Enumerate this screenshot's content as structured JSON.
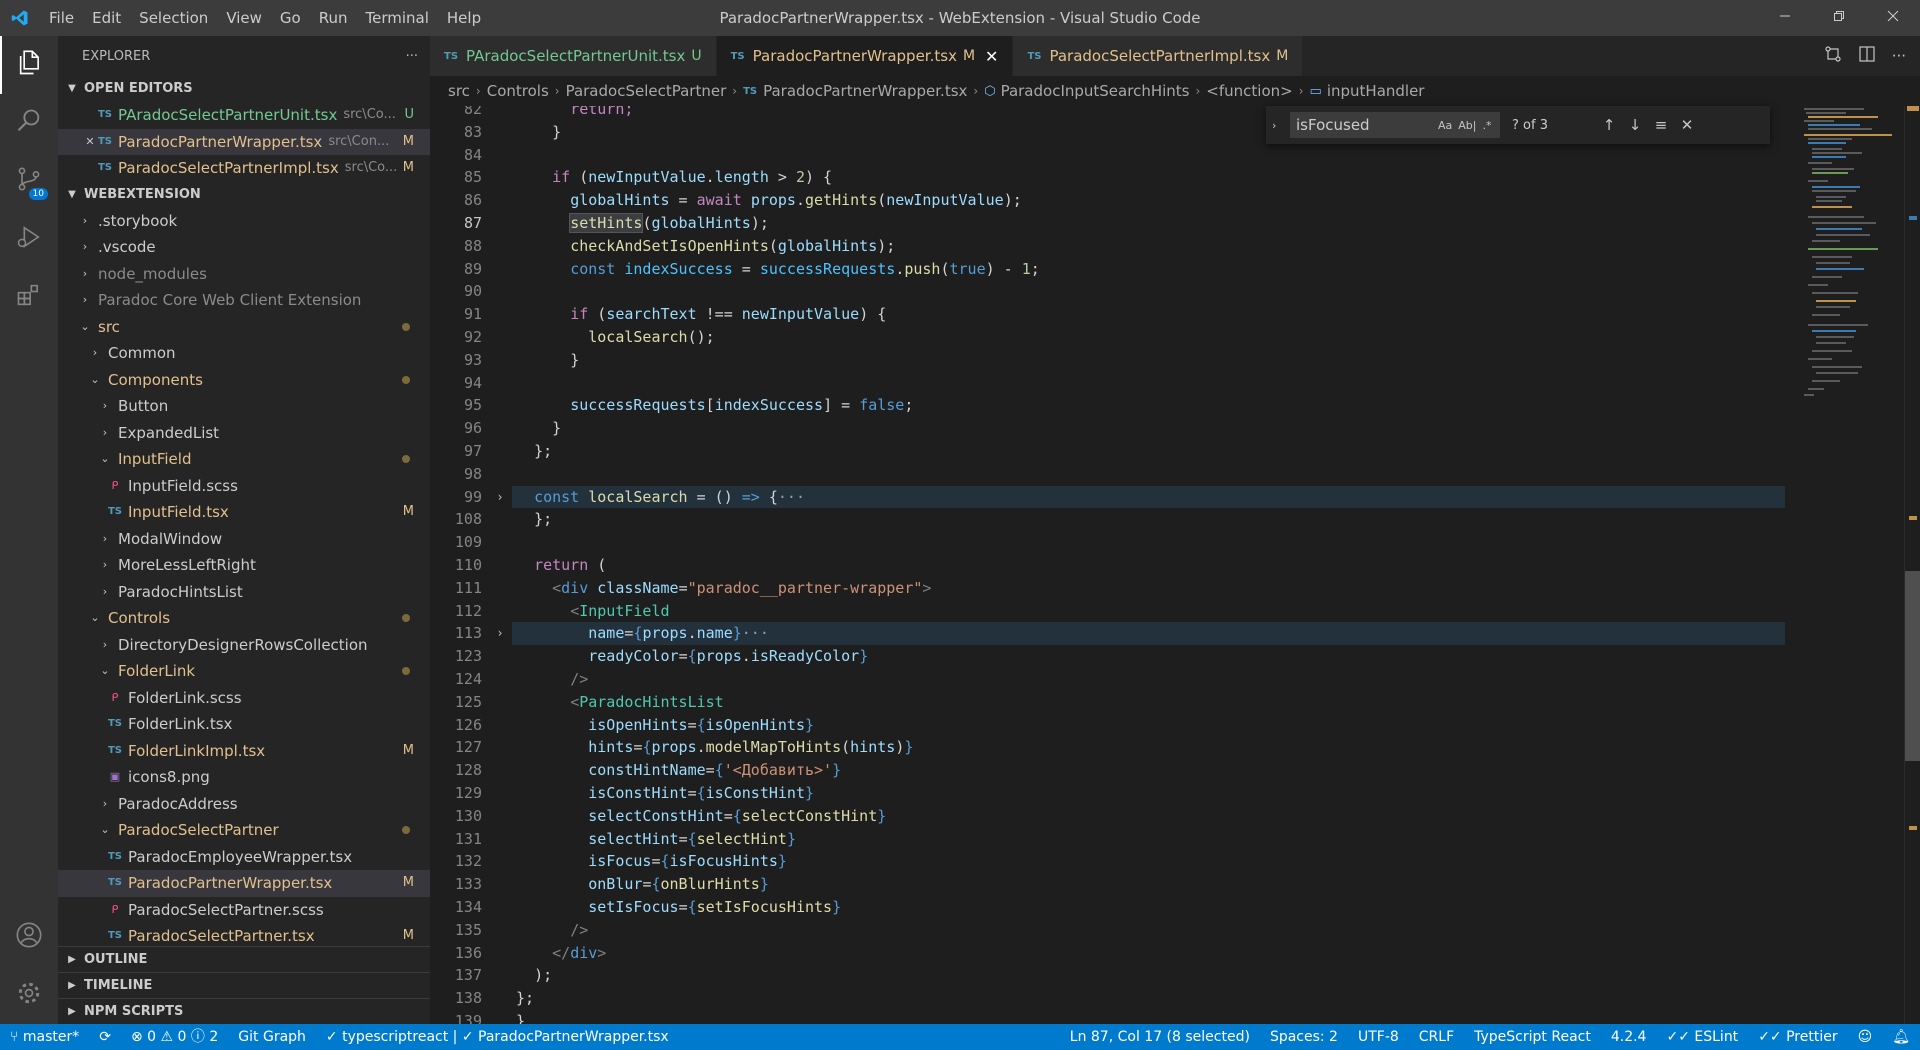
{
  "titlebar": {
    "menu": [
      "File",
      "Edit",
      "Selection",
      "View",
      "Go",
      "Run",
      "Terminal",
      "Help"
    ],
    "title": "ParadocPartnerWrapper.tsx - WebExtension - Visual Studio Code"
  },
  "activity": {
    "scm_badge": "10"
  },
  "sidebar": {
    "header": "EXPLORER",
    "more": "···",
    "open_editors": {
      "title": "OPEN EDITORS",
      "items": [
        {
          "name": "PAradocSelectPartnerUnit.tsx",
          "path": "src\\Co...",
          "status": "U"
        },
        {
          "name": "ParadocPartnerWrapper.tsx",
          "path": "src\\Con...",
          "status": "M"
        },
        {
          "name": "ParadocSelectPartnerImpl.tsx",
          "path": "src\\Co...",
          "status": "M"
        }
      ]
    },
    "workspace": {
      "title": "WEBEXTENSION",
      "items": [
        {
          "name": ".storybook"
        },
        {
          "name": ".vscode"
        },
        {
          "name": "node_modules"
        },
        {
          "name": "Paradoc Core Web Client Extension"
        },
        {
          "name": "src"
        },
        {
          "name": "Common"
        },
        {
          "name": "Components"
        },
        {
          "name": "Button"
        },
        {
          "name": "ExpandedList"
        },
        {
          "name": "InputField"
        },
        {
          "name": "InputField.scss"
        },
        {
          "name": "InputField.tsx",
          "status": "M"
        },
        {
          "name": "ModalWindow"
        },
        {
          "name": "MoreLessLeftRight"
        },
        {
          "name": "ParadocHintsList"
        },
        {
          "name": "Controls"
        },
        {
          "name": "DirectoryDesignerRowsCollection"
        },
        {
          "name": "FolderLink"
        },
        {
          "name": "FolderLink.scss"
        },
        {
          "name": "FolderLink.tsx"
        },
        {
          "name": "FolderLinkImpl.tsx",
          "status": "M"
        },
        {
          "name": "icons8.png"
        },
        {
          "name": "ParadocAddress"
        },
        {
          "name": "ParadocSelectPartner"
        },
        {
          "name": "ParadocEmployeeWrapper.tsx"
        },
        {
          "name": "ParadocPartnerWrapper.tsx",
          "status": "M"
        },
        {
          "name": "ParadocSelectPartner.scss"
        },
        {
          "name": "ParadocSelectPartner.tsx",
          "status": "M"
        }
      ]
    },
    "bottom_sections": [
      "OUTLINE",
      "TIMELINE",
      "NPM SCRIPTS"
    ]
  },
  "tabs": [
    {
      "name": "PAradocSelectPartnerUnit.tsx",
      "status": "U"
    },
    {
      "name": "ParadocPartnerWrapper.tsx",
      "status": "M"
    },
    {
      "name": "ParadocSelectPartnerImpl.tsx",
      "status": "M"
    }
  ],
  "breadcrumb": [
    "src",
    "Controls",
    "ParadocSelectPartner",
    "ParadocPartnerWrapper.tsx",
    "ParadocInputSearchHints",
    "<function>",
    "inputHandler"
  ],
  "find": {
    "value": "isFocused",
    "count": "? of 3",
    "opt_case": "Aa",
    "opt_word": "Ab|",
    "opt_regex": ".*"
  },
  "editor": {
    "line_numbers": [
      "82",
      "83",
      "84",
      "85",
      "86",
      "87",
      "88",
      "89",
      "90",
      "91",
      "92",
      "93",
      "94",
      "95",
      "96",
      "97",
      "98",
      "99",
      "108",
      "109",
      "110",
      "111",
      "112",
      "113",
      "123",
      "124",
      "125",
      "126",
      "127",
      "128",
      "129",
      "130",
      "131",
      "132",
      "133",
      "134",
      "135",
      "136",
      "137",
      "138",
      "139"
    ],
    "current_line": "87",
    "lines": {
      "l82": "return;",
      "l83": "}",
      "l85a": "if",
      "l85b": "newInputValue",
      "l85c": "length",
      "l85d": "2",
      "l86a": "globalHints",
      "l86b": "await",
      "l86c": "props",
      "l86d": "getHints",
      "l86e": "newInputValue",
      "l87a": "setHints",
      "l87b": "globalHints",
      "l88a": "checkAndSetIsOpenHints",
      "l88b": "globalHints",
      "l89a": "const",
      "l89b": "indexSuccess",
      "l89c": "successRequests",
      "l89d": "push",
      "l89e": "true",
      "l89f": "1",
      "l91a": "if",
      "l91b": "searchText",
      "l91c": "newInputValue",
      "l92a": "localSearch",
      "l95a": "successRequests",
      "l95b": "indexSuccess",
      "l95c": "false",
      "l99a": "const",
      "l99b": "localSearch",
      "l99c": "=>",
      "l110a": "return",
      "l111a": "div",
      "l111b": "className",
      "l111c": "\"paradoc__partner-wrapper\"",
      "l112a": "InputField",
      "l113a": "name",
      "l113b": "props",
      "l113c": "name",
      "l123a": "readyColor",
      "l123b": "props",
      "l123c": "isReadyColor",
      "l125a": "ParadocHintsList",
      "l126a": "isOpenHints",
      "l126b": "isOpenHints",
      "l127a": "hints",
      "l127b": "props",
      "l127c": "modelMapToHints",
      "l127d": "hints",
      "l128a": "constHintName",
      "l128b": "'<Добавить>'",
      "l129a": "isConstHint",
      "l129b": "isConstHint",
      "l130a": "selectConstHint",
      "l130b": "selectConstHint",
      "l131a": "selectHint",
      "l131b": "selectHint",
      "l132a": "isFocus",
      "l132b": "isFocusHints",
      "l133a": "onBlur",
      "l133b": "onBlurHints",
      "l134a": "setIsFocus",
      "l134b": "setIsFocusHints",
      "l136a": "div"
    }
  },
  "status": {
    "branch": "master*",
    "errors": "0",
    "warnings": "0",
    "info": "2",
    "git_graph": "Git Graph",
    "ts_check": "typescriptreact | ✓ ParadocPartnerWrapper.tsx",
    "cursor": "Ln 87, Col 17 (8 selected)",
    "spaces": "Spaces: 2",
    "encoding": "UTF-8",
    "eol": "CRLF",
    "language": "TypeScript React",
    "version": "4.2.4",
    "eslint": "ESLint",
    "prettier": "Prettier"
  },
  "colors": {
    "accent": "#007acc",
    "modified": "#e2c08d",
    "untracked": "#73c991"
  }
}
